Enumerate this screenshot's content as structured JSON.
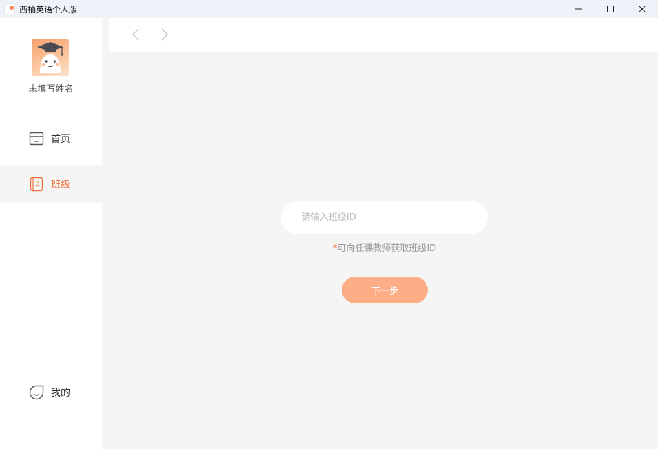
{
  "window": {
    "title": "西柚英语个人版",
    "controls": [
      "minimize",
      "maximize",
      "close"
    ]
  },
  "sidebar": {
    "user_name": "未填写姓名",
    "items": [
      {
        "label": "首页",
        "icon": "home-icon",
        "active": false
      },
      {
        "label": "班级",
        "icon": "class-book-icon",
        "active": true
      },
      {
        "label": "我的",
        "icon": "profile-icon",
        "active": false
      }
    ]
  },
  "main": {
    "class_input": {
      "value": "",
      "placeholder": "请输入班级ID"
    },
    "hint_star": "*",
    "hint_text": "可向任课教师获取班级ID",
    "next_label": "下一步"
  },
  "colors": {
    "accent": "#f2733f",
    "button": "#fdae87",
    "background": "#f5f5f5",
    "titlebar": "#eef3fa"
  }
}
